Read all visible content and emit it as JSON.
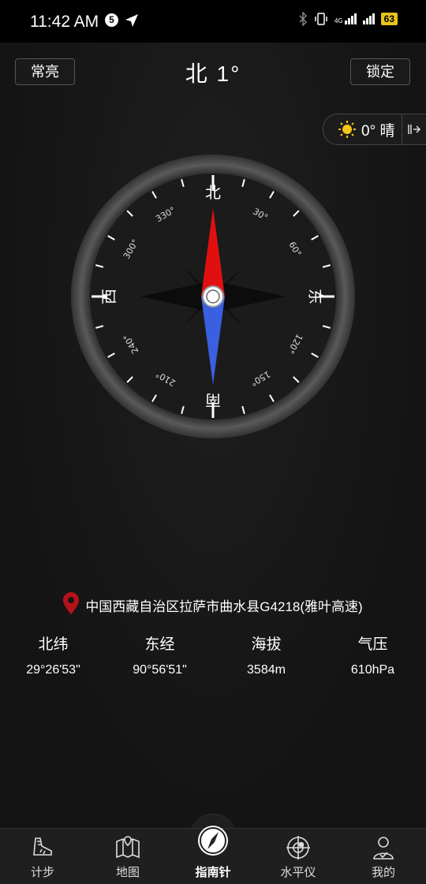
{
  "status_bar": {
    "time": "11:42 AM",
    "badge": "5",
    "network": "4G",
    "battery": "63"
  },
  "header": {
    "left_button": "常亮",
    "title": "北 1°",
    "right_button": "锁定"
  },
  "weather": {
    "text": "0° 晴",
    "icon": "sun-icon"
  },
  "compass": {
    "heading_deg": 1,
    "cardinals": {
      "north": "北",
      "east": "东",
      "south": "南",
      "west": "西"
    },
    "degree_labels": [
      "30°",
      "60°",
      "120°",
      "150°",
      "210°",
      "240°",
      "300°",
      "330°"
    ]
  },
  "location": {
    "address": "中国西藏自治区拉萨市曲水县G4218(雅叶高速)"
  },
  "stats": [
    {
      "label": "北纬",
      "value": "29°26'53\""
    },
    {
      "label": "东经",
      "value": "90°56'51\""
    },
    {
      "label": "海拔",
      "value": "3584m"
    },
    {
      "label": "气压",
      "value": "610hPa"
    }
  ],
  "nav": [
    {
      "label": "计步",
      "icon": "shoe-icon"
    },
    {
      "label": "地图",
      "icon": "map-icon"
    },
    {
      "label": "指南针",
      "icon": "compass-icon"
    },
    {
      "label": "水平仪",
      "icon": "level-icon"
    },
    {
      "label": "我的",
      "icon": "profile-icon"
    }
  ],
  "colors": {
    "needle_north": "#e01010",
    "needle_south": "#3a5fe0",
    "accent_battery": "#e8c31a",
    "location_pin": "#b5121b"
  }
}
